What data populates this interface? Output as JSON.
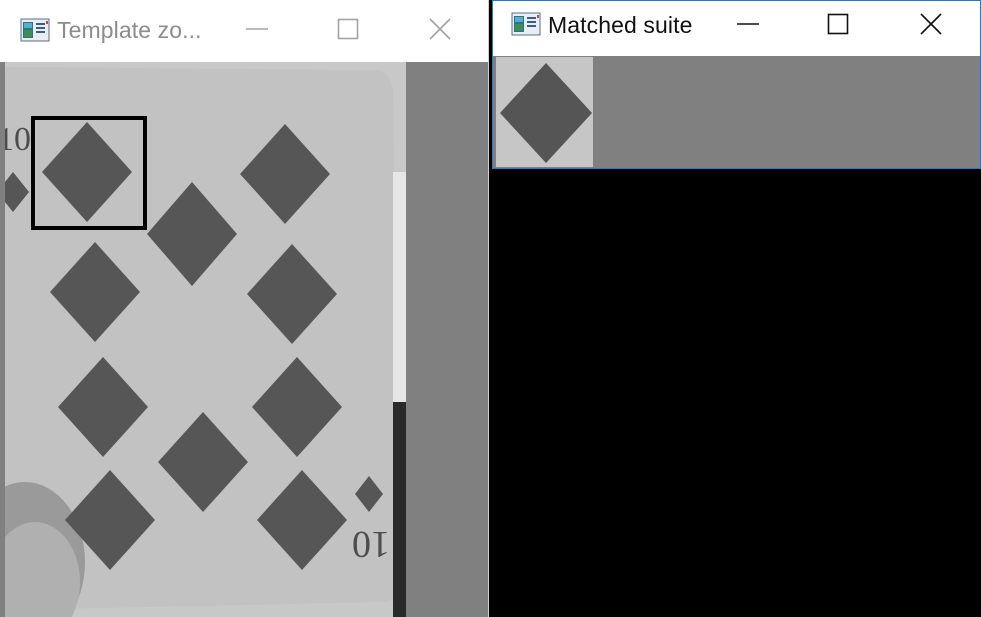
{
  "windows": {
    "template": {
      "title": "Template zo...",
      "icon": "opencv-window-icon",
      "controls": [
        "minimize-icon",
        "maximize-icon",
        "close-icon"
      ],
      "content": "playing card ten of diamonds with match rectangle around top-left pip"
    },
    "matched": {
      "title": "Matched suite",
      "icon": "opencv-window-icon",
      "controls": [
        "minimize-icon",
        "maximize-icon",
        "close-icon"
      ],
      "content": "cropped diamond suit symbol"
    }
  },
  "colors": {
    "desktop": "#000000",
    "canvas_gray": "#808080",
    "card": "#c2c2c2",
    "pip": "#565656",
    "match_box": "#000000",
    "active_border": "#2b78c9"
  },
  "card": {
    "rank_text": "10"
  }
}
